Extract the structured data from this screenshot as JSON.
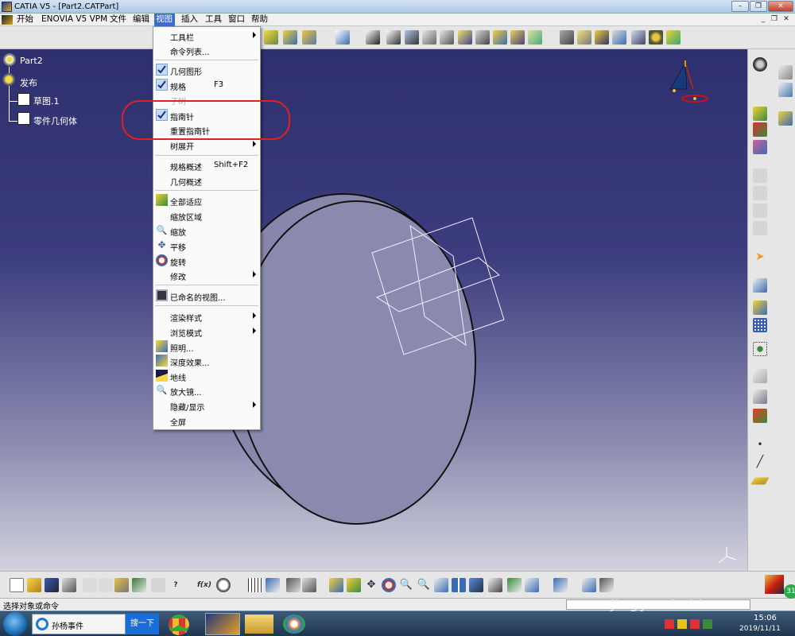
{
  "window": {
    "title": "CATIA V5 - [Part2.CATPart]"
  },
  "menubar": {
    "items": [
      {
        "label": "开始"
      },
      {
        "label": "ENOVIA V5 VPM"
      },
      {
        "label": "文件"
      },
      {
        "label": "编辑"
      },
      {
        "label": "视图"
      },
      {
        "label": "插入"
      },
      {
        "label": "工具"
      },
      {
        "label": "窗口"
      },
      {
        "label": "帮助"
      }
    ],
    "active": "视图"
  },
  "tree": {
    "root": "Part2",
    "items": [
      {
        "label": "发布"
      },
      {
        "label": "草图.1"
      },
      {
        "label": "零件几何体"
      }
    ]
  },
  "view_menu": {
    "items": [
      {
        "label": "工具栏",
        "submenu": true
      },
      {
        "label": "命令列表..."
      },
      {
        "label": "几何图形",
        "checked": true
      },
      {
        "label": "规格",
        "shortcut": "F3",
        "checked": true
      },
      {
        "label": "子树",
        "disabled": true
      },
      {
        "label": "指南针",
        "checked": true
      },
      {
        "label": "重置指南针"
      },
      {
        "label": "树展开",
        "submenu": true
      },
      {
        "label": "规格概述",
        "shortcut": "Shift+F2"
      },
      {
        "label": "几何概述"
      },
      {
        "label": "全部适应",
        "icon": "fit-all-icon"
      },
      {
        "label": "缩放区域"
      },
      {
        "label": "缩放",
        "icon": "zoom-icon"
      },
      {
        "label": "平移",
        "icon": "pan-icon"
      },
      {
        "label": "旋转",
        "icon": "rotate-icon"
      },
      {
        "label": "修改",
        "submenu": true
      },
      {
        "label": "已命名的视图...",
        "icon": "named-views-icon"
      },
      {
        "label": "渲染样式",
        "submenu": true
      },
      {
        "label": "浏览模式",
        "submenu": true
      },
      {
        "label": "照明...",
        "icon": "lighting-icon"
      },
      {
        "label": "深度效果...",
        "icon": "depth-effect-icon"
      },
      {
        "label": "地线",
        "icon": "ground-icon"
      },
      {
        "label": "放大镜...",
        "icon": "magnifier-icon"
      },
      {
        "label": "隐藏/显示",
        "submenu": true
      },
      {
        "label": "全屏"
      }
    ]
  },
  "statusbar": {
    "prompt": "选择对象或命令"
  },
  "taskbar": {
    "ie_title": "孙杨事件",
    "search_button": "搜一下",
    "clock_time": "15:06",
    "clock_date": "2019/11/11",
    "badge": "31"
  },
  "watermark": {
    "text": "jingyan.baidu.com"
  },
  "colors": {
    "menu_highlight": "#3c6ec8",
    "annotation": "#e32020",
    "viewport_top": "#2e2f6e",
    "viewport_bottom": "#d2d2de"
  }
}
